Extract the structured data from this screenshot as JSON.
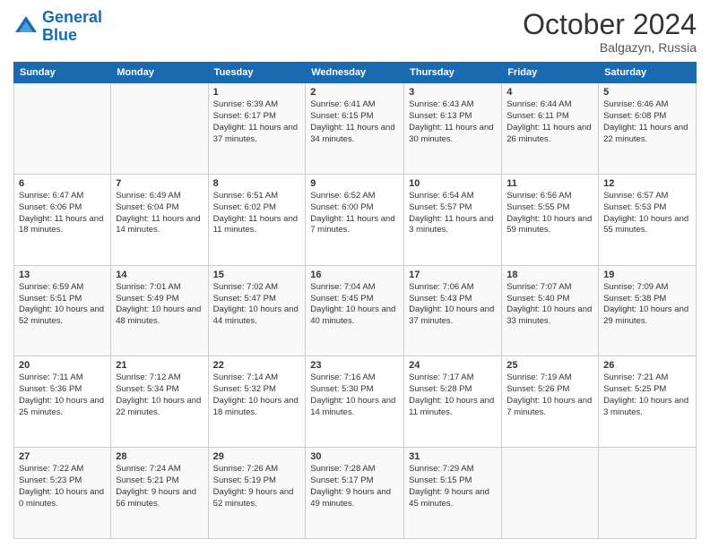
{
  "header": {
    "logo_line1": "General",
    "logo_line2": "Blue",
    "month": "October 2024",
    "location": "Balgazyn, Russia"
  },
  "weekdays": [
    "Sunday",
    "Monday",
    "Tuesday",
    "Wednesday",
    "Thursday",
    "Friday",
    "Saturday"
  ],
  "rows": [
    [
      {
        "day": "",
        "info": ""
      },
      {
        "day": "",
        "info": ""
      },
      {
        "day": "1",
        "info": "Sunrise: 6:39 AM\nSunset: 6:17 PM\nDaylight: 11 hours and 37 minutes."
      },
      {
        "day": "2",
        "info": "Sunrise: 6:41 AM\nSunset: 6:15 PM\nDaylight: 11 hours and 34 minutes."
      },
      {
        "day": "3",
        "info": "Sunrise: 6:43 AM\nSunset: 6:13 PM\nDaylight: 11 hours and 30 minutes."
      },
      {
        "day": "4",
        "info": "Sunrise: 6:44 AM\nSunset: 6:11 PM\nDaylight: 11 hours and 26 minutes."
      },
      {
        "day": "5",
        "info": "Sunrise: 6:46 AM\nSunset: 6:08 PM\nDaylight: 11 hours and 22 minutes."
      }
    ],
    [
      {
        "day": "6",
        "info": "Sunrise: 6:47 AM\nSunset: 6:06 PM\nDaylight: 11 hours and 18 minutes."
      },
      {
        "day": "7",
        "info": "Sunrise: 6:49 AM\nSunset: 6:04 PM\nDaylight: 11 hours and 14 minutes."
      },
      {
        "day": "8",
        "info": "Sunrise: 6:51 AM\nSunset: 6:02 PM\nDaylight: 11 hours and 11 minutes."
      },
      {
        "day": "9",
        "info": "Sunrise: 6:52 AM\nSunset: 6:00 PM\nDaylight: 11 hours and 7 minutes."
      },
      {
        "day": "10",
        "info": "Sunrise: 6:54 AM\nSunset: 5:57 PM\nDaylight: 11 hours and 3 minutes."
      },
      {
        "day": "11",
        "info": "Sunrise: 6:56 AM\nSunset: 5:55 PM\nDaylight: 10 hours and 59 minutes."
      },
      {
        "day": "12",
        "info": "Sunrise: 6:57 AM\nSunset: 5:53 PM\nDaylight: 10 hours and 55 minutes."
      }
    ],
    [
      {
        "day": "13",
        "info": "Sunrise: 6:59 AM\nSunset: 5:51 PM\nDaylight: 10 hours and 52 minutes."
      },
      {
        "day": "14",
        "info": "Sunrise: 7:01 AM\nSunset: 5:49 PM\nDaylight: 10 hours and 48 minutes."
      },
      {
        "day": "15",
        "info": "Sunrise: 7:02 AM\nSunset: 5:47 PM\nDaylight: 10 hours and 44 minutes."
      },
      {
        "day": "16",
        "info": "Sunrise: 7:04 AM\nSunset: 5:45 PM\nDaylight: 10 hours and 40 minutes."
      },
      {
        "day": "17",
        "info": "Sunrise: 7:06 AM\nSunset: 5:43 PM\nDaylight: 10 hours and 37 minutes."
      },
      {
        "day": "18",
        "info": "Sunrise: 7:07 AM\nSunset: 5:40 PM\nDaylight: 10 hours and 33 minutes."
      },
      {
        "day": "19",
        "info": "Sunrise: 7:09 AM\nSunset: 5:38 PM\nDaylight: 10 hours and 29 minutes."
      }
    ],
    [
      {
        "day": "20",
        "info": "Sunrise: 7:11 AM\nSunset: 5:36 PM\nDaylight: 10 hours and 25 minutes."
      },
      {
        "day": "21",
        "info": "Sunrise: 7:12 AM\nSunset: 5:34 PM\nDaylight: 10 hours and 22 minutes."
      },
      {
        "day": "22",
        "info": "Sunrise: 7:14 AM\nSunset: 5:32 PM\nDaylight: 10 hours and 18 minutes."
      },
      {
        "day": "23",
        "info": "Sunrise: 7:16 AM\nSunset: 5:30 PM\nDaylight: 10 hours and 14 minutes."
      },
      {
        "day": "24",
        "info": "Sunrise: 7:17 AM\nSunset: 5:28 PM\nDaylight: 10 hours and 11 minutes."
      },
      {
        "day": "25",
        "info": "Sunrise: 7:19 AM\nSunset: 5:26 PM\nDaylight: 10 hours and 7 minutes."
      },
      {
        "day": "26",
        "info": "Sunrise: 7:21 AM\nSunset: 5:25 PM\nDaylight: 10 hours and 3 minutes."
      }
    ],
    [
      {
        "day": "27",
        "info": "Sunrise: 7:22 AM\nSunset: 5:23 PM\nDaylight: 10 hours and 0 minutes."
      },
      {
        "day": "28",
        "info": "Sunrise: 7:24 AM\nSunset: 5:21 PM\nDaylight: 9 hours and 56 minutes."
      },
      {
        "day": "29",
        "info": "Sunrise: 7:26 AM\nSunset: 5:19 PM\nDaylight: 9 hours and 52 minutes."
      },
      {
        "day": "30",
        "info": "Sunrise: 7:28 AM\nSunset: 5:17 PM\nDaylight: 9 hours and 49 minutes."
      },
      {
        "day": "31",
        "info": "Sunrise: 7:29 AM\nSunset: 5:15 PM\nDaylight: 9 hours and 45 minutes."
      },
      {
        "day": "",
        "info": ""
      },
      {
        "day": "",
        "info": ""
      }
    ]
  ]
}
